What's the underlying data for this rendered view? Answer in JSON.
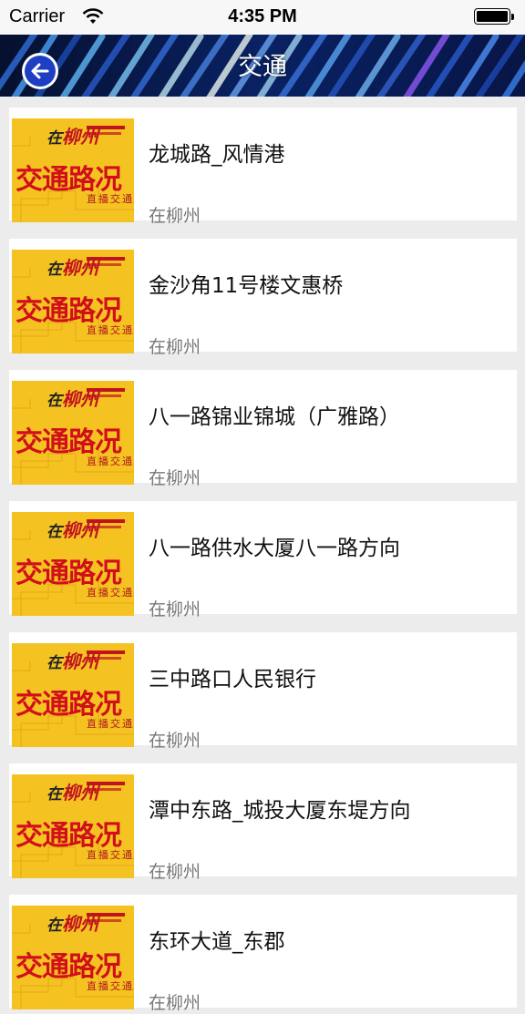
{
  "status_bar": {
    "carrier": "Carrier",
    "time": "4:35 PM"
  },
  "nav": {
    "title": "交通",
    "back_icon": "back-arrow-icon",
    "accent_color": "#1e3fc4"
  },
  "thumbnail": {
    "brand_prefix": "在",
    "brand_city": "柳州",
    "headline": "交通路况",
    "subline": "直播交通"
  },
  "items": [
    {
      "title": "龙城路_风情港",
      "source": "在柳州"
    },
    {
      "title": "金沙角11号楼文惠桥",
      "source": "在柳州"
    },
    {
      "title": "八一路锦业锦城（广雅路）",
      "source": "在柳州"
    },
    {
      "title": "八一路供水大厦八一路方向",
      "source": "在柳州"
    },
    {
      "title": "三中路口人民银行",
      "source": "在柳州"
    },
    {
      "title": "潭中东路_城投大厦东堤方向",
      "source": "在柳州"
    },
    {
      "title": "东环大道_东郡",
      "source": "在柳州"
    }
  ]
}
